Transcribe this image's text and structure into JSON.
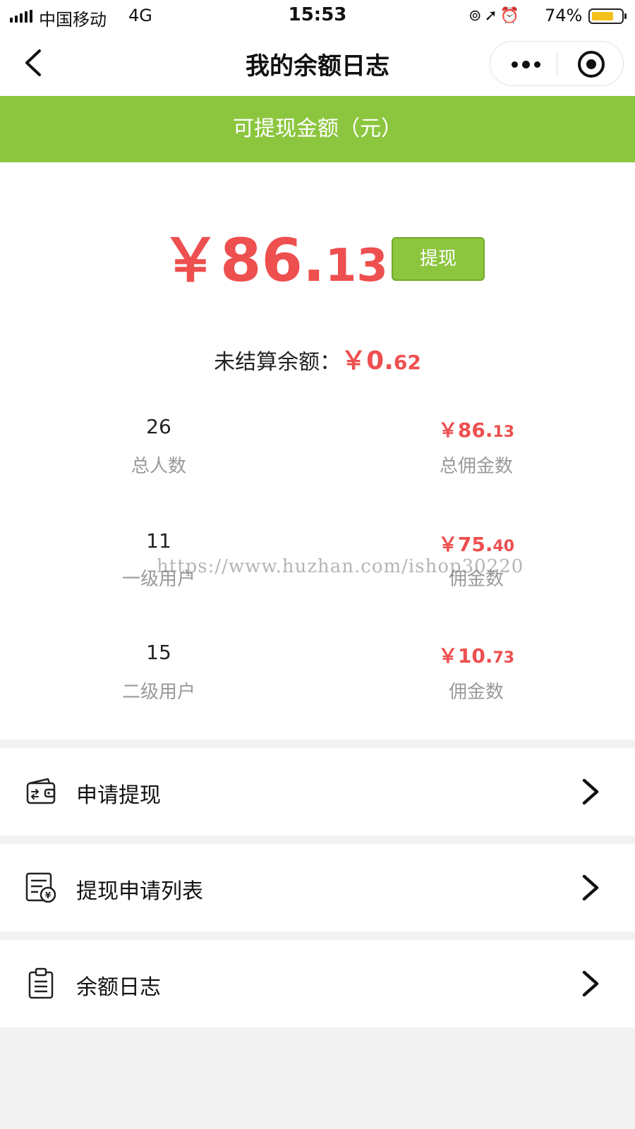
{
  "status_bar": {
    "carrier": "中国移动",
    "network": "4G",
    "time": "15:53",
    "battery_percent": "74%",
    "battery_level": 0.74,
    "icons": [
      "rotation-lock-icon",
      "location-icon",
      "alarm-icon"
    ]
  },
  "nav": {
    "title": "我的余额日志"
  },
  "header": {
    "label": "可提现金额（元）"
  },
  "balance": {
    "currency": "￥",
    "amount_int": "86.",
    "amount_dec": "13",
    "withdraw_button": "提现"
  },
  "unsettled": {
    "label": "未结算余额：",
    "currency": "￥",
    "amount_int": "0.",
    "amount_dec": "62"
  },
  "stats": [
    {
      "left_value": "26",
      "left_label": "总人数",
      "right_currency": "￥",
      "right_int": "86.",
      "right_dec": "13",
      "right_label": "总佣金数"
    },
    {
      "left_value": "11",
      "left_label": "一级用户",
      "right_currency": "￥",
      "right_int": "75.",
      "right_dec": "40",
      "right_label": "佣金数"
    },
    {
      "left_value": "15",
      "left_label": "二级用户",
      "right_currency": "￥",
      "right_int": "10.",
      "right_dec": "73",
      "right_label": "佣金数"
    }
  ],
  "watermark": "https://www.huzhan.com/ishop30220",
  "menu": [
    {
      "label": "申请提现",
      "icon": "wallet-icon"
    },
    {
      "label": "提现申请列表",
      "icon": "bill-list-icon"
    },
    {
      "label": "余额日志",
      "icon": "clipboard-icon"
    }
  ],
  "colors": {
    "accent_green": "#8cc63f",
    "amount_red": "#ee4f4f",
    "muted_text": "#9a9a9a",
    "page_bg": "#f2f2f2"
  }
}
